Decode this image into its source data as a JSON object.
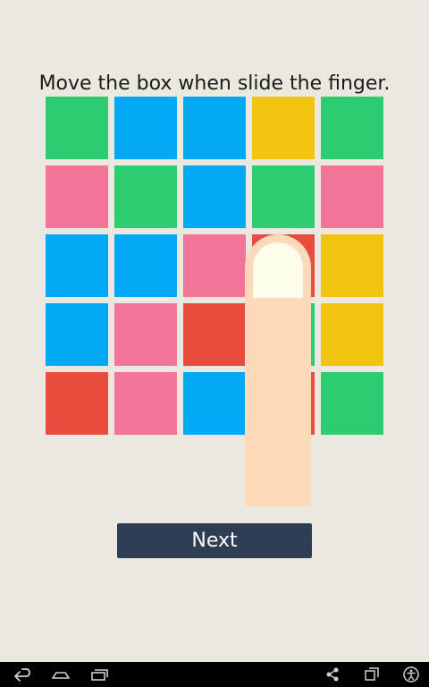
{
  "instruction": "Move the box when slide the finger.",
  "colors": {
    "green": "#2ecc71",
    "blue": "#03a9f4",
    "yellow": "#f1c40f",
    "pink": "#f27599",
    "red": "#e74c3c",
    "background": "#ebe8e0",
    "button": "#2e3e55",
    "finger": "#fcd9b9",
    "nail": "#fdfdec"
  },
  "grid": [
    [
      "green",
      "blue",
      "blue",
      "yellow",
      "green"
    ],
    [
      "pink",
      "green",
      "blue",
      "green",
      "pink"
    ],
    [
      "blue",
      "blue",
      "pink",
      "red",
      "yellow"
    ],
    [
      "blue",
      "pink",
      "red",
      "green",
      "yellow"
    ],
    [
      "red",
      "pink",
      "blue",
      "red",
      "green"
    ]
  ],
  "overlay": {
    "icon": "finger-pointer-icon"
  },
  "next_button": {
    "label": "Next"
  },
  "navbar": {
    "left_icons": [
      "back-icon",
      "home-icon",
      "recent-apps-icon"
    ],
    "right_icons": [
      "share-icon",
      "screen-rotate-icon",
      "accessibility-icon"
    ]
  }
}
